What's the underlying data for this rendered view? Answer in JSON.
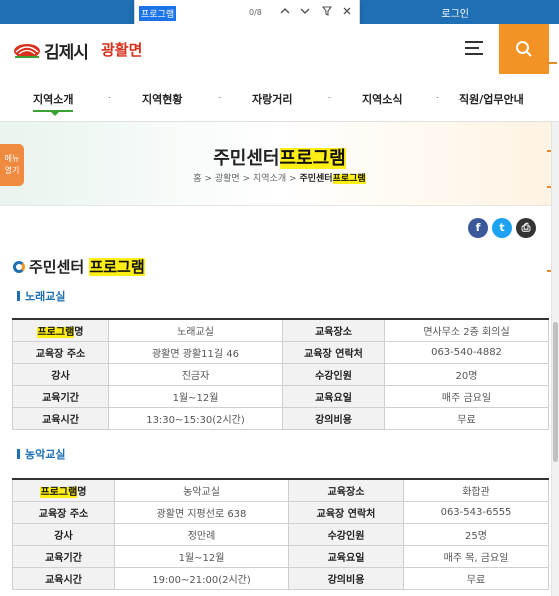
{
  "topbar": {
    "login": "로그인"
  },
  "findbar": {
    "query": "프로그램",
    "count": "0/8"
  },
  "header": {
    "logo_text": "김제시",
    "logo_sub": "광활면"
  },
  "nav": {
    "items": [
      {
        "label": "지역소개"
      },
      {
        "label": "지역현황"
      },
      {
        "label": "자랑거리"
      },
      {
        "label": "지역소식"
      },
      {
        "label": "직원/업무안내"
      }
    ]
  },
  "side_menu": {
    "line1": "메뉴",
    "line2": "열기"
  },
  "hero": {
    "title_plain": "주민센터",
    "title_highlight": "프로그램",
    "breadcrumb": {
      "home": "홈",
      "sep": ">",
      "level1": "광활면",
      "level2": "지역소개",
      "current_plain": "주민센터",
      "current_highlight": "프로그램"
    }
  },
  "share": {
    "facebook": "f",
    "twitter": "t",
    "print": "⎙"
  },
  "section": {
    "title_plain": "주민센터",
    "title_highlight": "프로그램"
  },
  "programs": [
    {
      "name": "노래교실",
      "rows": [
        {
          "l1_hl": "프로그램",
          "l1": "명",
          "v1": "노래교실",
          "l2": "교육장소",
          "v2": "면사무소 2층 회의실"
        },
        {
          "l1_hl": "",
          "l1": "교육장 주소",
          "v1": "광활면 광활11길 46",
          "l2": "교육장 연락처",
          "v2": "063-540-4882"
        },
        {
          "l1_hl": "",
          "l1": "강사",
          "v1": "진금자",
          "l2": "수강인원",
          "v2": "20명"
        },
        {
          "l1_hl": "",
          "l1": "교육기간",
          "v1": "1월~12월",
          "l2": "교육요일",
          "v2": "매주 금요일"
        },
        {
          "l1_hl": "",
          "l1": "교육시간",
          "v1": "13:30~15:30(2시간)",
          "l2": "강의비용",
          "v2": "무료"
        }
      ]
    },
    {
      "name": "농악교실",
      "rows": [
        {
          "l1_hl": "프로그램",
          "l1": "명",
          "v1": "농악교실",
          "l2": "교육장소",
          "v2": "화합관"
        },
        {
          "l1_hl": "",
          "l1": "교육장 주소",
          "v1": "광활면 지평선로 638",
          "l2": "교육장 연락처",
          "v2": "063-543-6555"
        },
        {
          "l1_hl": "",
          "l1": "강사",
          "v1": "정만례",
          "l2": "수강인원",
          "v2": "25명"
        },
        {
          "l1_hl": "",
          "l1": "교육기간",
          "v1": "1월~12월",
          "l2": "교육요일",
          "v2": "매주 목, 금요일"
        },
        {
          "l1_hl": "",
          "l1": "교육시간",
          "v1": "19:00~21:00(2시간)",
          "l2": "강의비용",
          "v2": "무료"
        }
      ]
    }
  ],
  "colors": {
    "brand_blue": "#1e6fb4",
    "accent_orange": "#f39325",
    "highlight": "#ffef16",
    "nav_green": "#3aa335"
  }
}
